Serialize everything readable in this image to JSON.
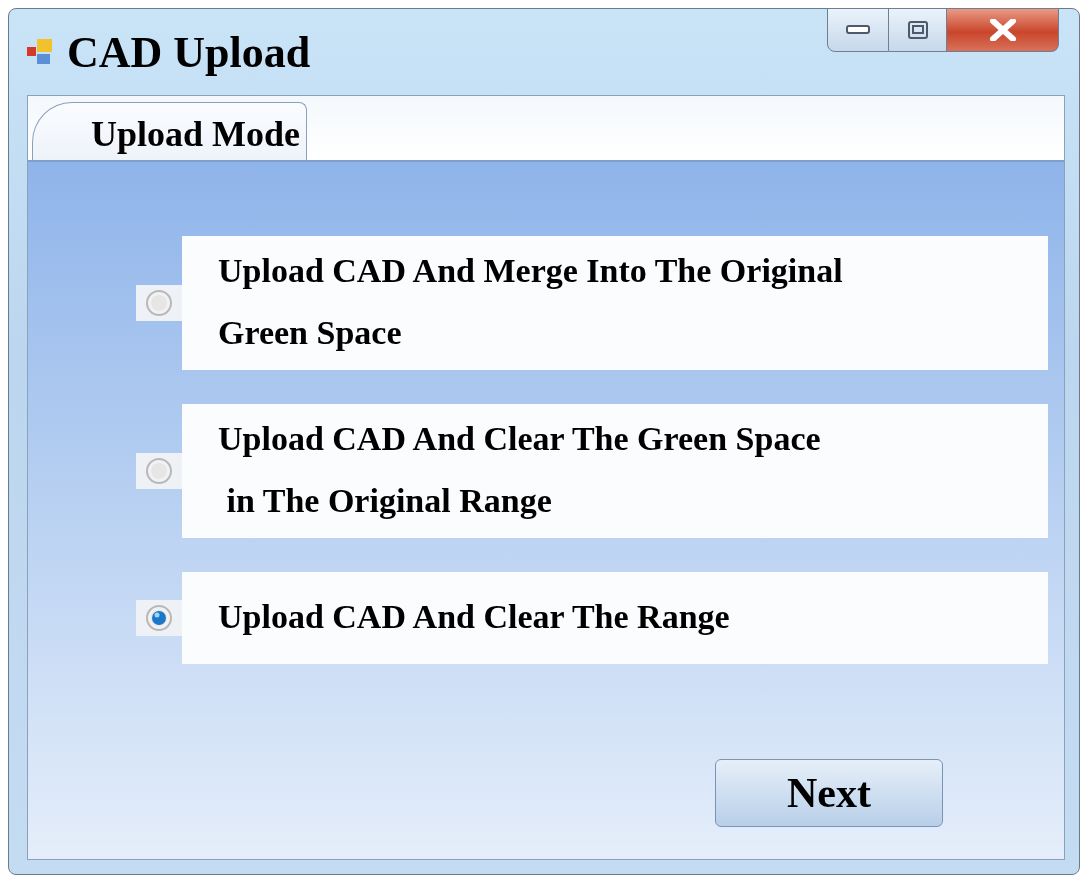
{
  "window": {
    "title": "CAD Upload"
  },
  "tabs": [
    {
      "label": "Upload Mode",
      "selected": true
    }
  ],
  "options": [
    {
      "lines": [
        "Upload CAD And Merge Into The Original",
        "Green Space"
      ],
      "selected": false
    },
    {
      "lines": [
        "Upload CAD And Clear The Green Space",
        " in The Original Range"
      ],
      "selected": false
    },
    {
      "lines": [
        "Upload CAD And Clear The Range"
      ],
      "selected": true
    }
  ],
  "buttons": [
    "Next"
  ]
}
